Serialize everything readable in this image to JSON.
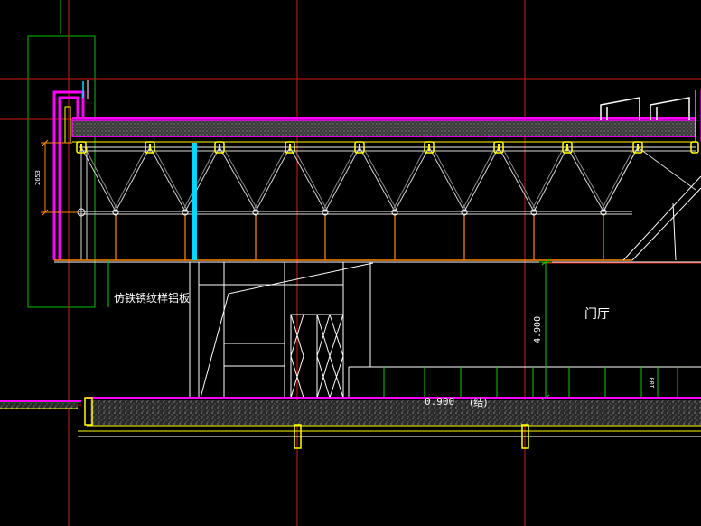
{
  "labels": {
    "material_note": "仿铁锈纹样铝板",
    "room_name": "门厅",
    "height_dim": "4.900",
    "elevation": "0.900",
    "elevation_suffix": "(结)",
    "truss_dim": "2653",
    "base_dim": "100"
  },
  "colors": {
    "background": "#000000",
    "axis": "#d01818",
    "truss": "#d8d8d8",
    "chord": "#f0f0f0",
    "node": "#ffff00",
    "hanger": "#ff8800",
    "wall": "#ff00ff",
    "gridline": "#00d000",
    "pillar": "#00e0ff",
    "slab": "#c8c8c8",
    "white": "#ffffff"
  }
}
